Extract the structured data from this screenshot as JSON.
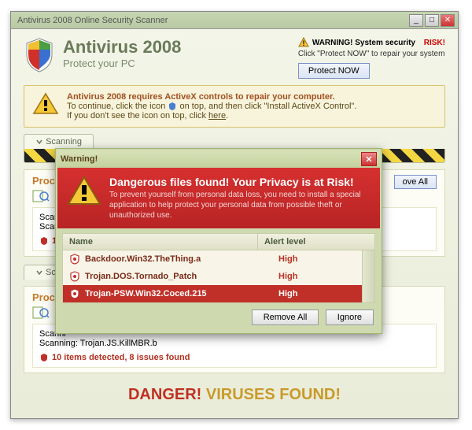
{
  "window": {
    "title": "Antivirus 2008 Online Security Scanner"
  },
  "header": {
    "app_name": "Antivirus 2008",
    "tagline": "Protect your PC",
    "warning_prefix": "WARNING! System security",
    "warning_risk": "RISK!",
    "warning_sub": "Click \"Protect NOW\" to repair your system",
    "protect_btn": "Protect NOW"
  },
  "notice": {
    "bold": "Antivirus 2008 requires ActiveX controls to repair your computer.",
    "line2a": "To continue, click the icon",
    "line2b": "on top, and then click \"Install ActiveX Control\".",
    "line3a": "If you don't see the icon on top, click",
    "line3_link": "here"
  },
  "tabs": {
    "scanning": "Scanning"
  },
  "process": {
    "title": "Proces",
    "remove_all": "ove All",
    "scanning_label": "Scanni",
    "scanning_file": "Scanni",
    "detected_count": "17"
  },
  "process2": {
    "tab": "Scann",
    "title": "Proces",
    "scanning_label": "Scanni",
    "scanning_file": "Scanning: Trojan.JS.KillMBR.b",
    "detected": "10 items detected, 8 issues found"
  },
  "danger": {
    "pre": "DANGER!",
    "post": "VIRUSES FOUND!"
  },
  "modal": {
    "title": "Warning!",
    "headline": "Dangerous files found! Your Privacy is at Risk!",
    "body": "To prevent yourself from personal data loss, you need to install a special application to help protect your personal data from possible theft or unauthorized use.",
    "col_name": "Name",
    "col_alert": "Alert level",
    "rows": [
      {
        "name": "Backdoor.Win32.TheThing.a",
        "level": "High",
        "selected": false
      },
      {
        "name": "Trojan.DOS.Tornado_Patch",
        "level": "High",
        "selected": false
      },
      {
        "name": "Trojan-PSW.Win32.Coced.215",
        "level": "High",
        "selected": true
      }
    ],
    "btn_remove": "Remove All",
    "btn_ignore": "Ignore"
  }
}
